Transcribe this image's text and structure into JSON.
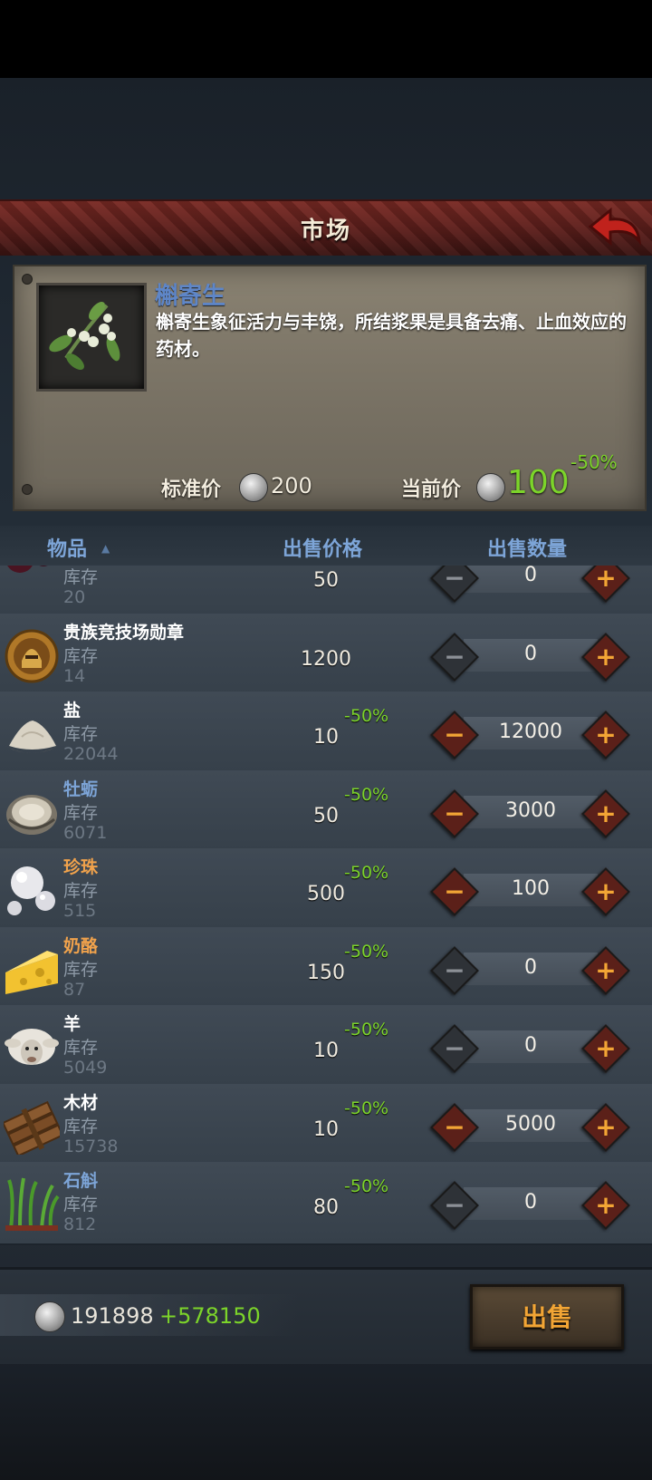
{
  "header": {
    "title": "市场"
  },
  "selected_item": {
    "name": "槲寄生",
    "description": "槲寄生象征活力与丰饶，所结浆果是具备去痛、止血效应的药材。",
    "standard_price_label": "标准价",
    "standard_price": "200",
    "current_price_label": "当前价",
    "current_price": "100",
    "discount": "-50%"
  },
  "columns": {
    "item": "物品",
    "price": "出售价格",
    "quantity": "出售数量"
  },
  "stock_label": "库存",
  "rows": [
    {
      "name": "",
      "name_color": "#ffffff",
      "stock": "20",
      "price": "50",
      "discount": "",
      "quantity": "0",
      "icon": "berries-icon",
      "minus_enabled": false
    },
    {
      "name": "贵族竞技场勋章",
      "name_color": "#ffffff",
      "stock": "14",
      "price": "1200",
      "discount": "",
      "quantity": "0",
      "icon": "medal-icon",
      "minus_enabled": false
    },
    {
      "name": "盐",
      "name_color": "#ffffff",
      "stock": "22044",
      "price": "10",
      "discount": "-50%",
      "quantity": "12000",
      "icon": "salt-icon",
      "minus_enabled": true
    },
    {
      "name": "牡蛎",
      "name_color": "#7da5d8",
      "stock": "6071",
      "price": "50",
      "discount": "-50%",
      "quantity": "3000",
      "icon": "oyster-icon",
      "minus_enabled": true
    },
    {
      "name": "珍珠",
      "name_color": "#f0a24c",
      "stock": "515",
      "price": "500",
      "discount": "-50%",
      "quantity": "100",
      "icon": "pearl-icon",
      "minus_enabled": true
    },
    {
      "name": "奶酪",
      "name_color": "#f0a24c",
      "stock": "87",
      "price": "150",
      "discount": "-50%",
      "quantity": "0",
      "icon": "cheese-icon",
      "minus_enabled": false
    },
    {
      "name": "羊",
      "name_color": "#ffffff",
      "stock": "5049",
      "price": "10",
      "discount": "-50%",
      "quantity": "0",
      "icon": "sheep-icon",
      "minus_enabled": false
    },
    {
      "name": "木材",
      "name_color": "#ffffff",
      "stock": "15738",
      "price": "10",
      "discount": "-50%",
      "quantity": "5000",
      "icon": "wood-icon",
      "minus_enabled": true
    },
    {
      "name": "石斛",
      "name_color": "#7da5d8",
      "stock": "812",
      "price": "80",
      "discount": "-50%",
      "quantity": "0",
      "icon": "herb-icon",
      "minus_enabled": false
    }
  ],
  "footer": {
    "money": "191898",
    "money_gain": "+578150",
    "sell_label": "出售"
  },
  "colors": {
    "accent_green": "#7cd42a",
    "button_orange": "#f2a535",
    "header_blue": "#7da5d8",
    "title_red": "#5b1e1b"
  }
}
